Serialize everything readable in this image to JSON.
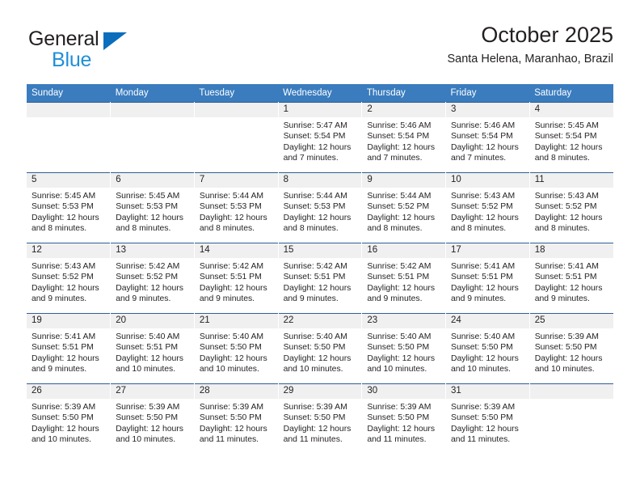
{
  "brand": {
    "name_top": "General",
    "name_bottom": "Blue",
    "triangle_color": "#0a6ebd",
    "blue_text_color": "#1f8fd8",
    "dark_text_color": "#231f20"
  },
  "header": {
    "title": "October 2025",
    "subtitle": "Santa Helena, Maranhao, Brazil"
  },
  "theme": {
    "header_bar_color": "#3a7cbe",
    "row_border_color": "#2f5f94",
    "daynum_bg_color": "#f0f0f0",
    "cell_bg_color": "#ffffff"
  },
  "calendar": {
    "weekday_headers": [
      "Sunday",
      "Monday",
      "Tuesday",
      "Wednesday",
      "Thursday",
      "Friday",
      "Saturday"
    ],
    "weeks": [
      [
        {
          "day": "",
          "sunrise": "",
          "sunset": "",
          "daylight_line1": "",
          "daylight_line2": ""
        },
        {
          "day": "",
          "sunrise": "",
          "sunset": "",
          "daylight_line1": "",
          "daylight_line2": ""
        },
        {
          "day": "",
          "sunrise": "",
          "sunset": "",
          "daylight_line1": "",
          "daylight_line2": ""
        },
        {
          "day": "1",
          "sunrise": "Sunrise: 5:47 AM",
          "sunset": "Sunset: 5:54 PM",
          "daylight_line1": "Daylight: 12 hours",
          "daylight_line2": "and 7 minutes."
        },
        {
          "day": "2",
          "sunrise": "Sunrise: 5:46 AM",
          "sunset": "Sunset: 5:54 PM",
          "daylight_line1": "Daylight: 12 hours",
          "daylight_line2": "and 7 minutes."
        },
        {
          "day": "3",
          "sunrise": "Sunrise: 5:46 AM",
          "sunset": "Sunset: 5:54 PM",
          "daylight_line1": "Daylight: 12 hours",
          "daylight_line2": "and 7 minutes."
        },
        {
          "day": "4",
          "sunrise": "Sunrise: 5:45 AM",
          "sunset": "Sunset: 5:54 PM",
          "daylight_line1": "Daylight: 12 hours",
          "daylight_line2": "and 8 minutes."
        }
      ],
      [
        {
          "day": "5",
          "sunrise": "Sunrise: 5:45 AM",
          "sunset": "Sunset: 5:53 PM",
          "daylight_line1": "Daylight: 12 hours",
          "daylight_line2": "and 8 minutes."
        },
        {
          "day": "6",
          "sunrise": "Sunrise: 5:45 AM",
          "sunset": "Sunset: 5:53 PM",
          "daylight_line1": "Daylight: 12 hours",
          "daylight_line2": "and 8 minutes."
        },
        {
          "day": "7",
          "sunrise": "Sunrise: 5:44 AM",
          "sunset": "Sunset: 5:53 PM",
          "daylight_line1": "Daylight: 12 hours",
          "daylight_line2": "and 8 minutes."
        },
        {
          "day": "8",
          "sunrise": "Sunrise: 5:44 AM",
          "sunset": "Sunset: 5:53 PM",
          "daylight_line1": "Daylight: 12 hours",
          "daylight_line2": "and 8 minutes."
        },
        {
          "day": "9",
          "sunrise": "Sunrise: 5:44 AM",
          "sunset": "Sunset: 5:52 PM",
          "daylight_line1": "Daylight: 12 hours",
          "daylight_line2": "and 8 minutes."
        },
        {
          "day": "10",
          "sunrise": "Sunrise: 5:43 AM",
          "sunset": "Sunset: 5:52 PM",
          "daylight_line1": "Daylight: 12 hours",
          "daylight_line2": "and 8 minutes."
        },
        {
          "day": "11",
          "sunrise": "Sunrise: 5:43 AM",
          "sunset": "Sunset: 5:52 PM",
          "daylight_line1": "Daylight: 12 hours",
          "daylight_line2": "and 8 minutes."
        }
      ],
      [
        {
          "day": "12",
          "sunrise": "Sunrise: 5:43 AM",
          "sunset": "Sunset: 5:52 PM",
          "daylight_line1": "Daylight: 12 hours",
          "daylight_line2": "and 9 minutes."
        },
        {
          "day": "13",
          "sunrise": "Sunrise: 5:42 AM",
          "sunset": "Sunset: 5:52 PM",
          "daylight_line1": "Daylight: 12 hours",
          "daylight_line2": "and 9 minutes."
        },
        {
          "day": "14",
          "sunrise": "Sunrise: 5:42 AM",
          "sunset": "Sunset: 5:51 PM",
          "daylight_line1": "Daylight: 12 hours",
          "daylight_line2": "and 9 minutes."
        },
        {
          "day": "15",
          "sunrise": "Sunrise: 5:42 AM",
          "sunset": "Sunset: 5:51 PM",
          "daylight_line1": "Daylight: 12 hours",
          "daylight_line2": "and 9 minutes."
        },
        {
          "day": "16",
          "sunrise": "Sunrise: 5:42 AM",
          "sunset": "Sunset: 5:51 PM",
          "daylight_line1": "Daylight: 12 hours",
          "daylight_line2": "and 9 minutes."
        },
        {
          "day": "17",
          "sunrise": "Sunrise: 5:41 AM",
          "sunset": "Sunset: 5:51 PM",
          "daylight_line1": "Daylight: 12 hours",
          "daylight_line2": "and 9 minutes."
        },
        {
          "day": "18",
          "sunrise": "Sunrise: 5:41 AM",
          "sunset": "Sunset: 5:51 PM",
          "daylight_line1": "Daylight: 12 hours",
          "daylight_line2": "and 9 minutes."
        }
      ],
      [
        {
          "day": "19",
          "sunrise": "Sunrise: 5:41 AM",
          "sunset": "Sunset: 5:51 PM",
          "daylight_line1": "Daylight: 12 hours",
          "daylight_line2": "and 9 minutes."
        },
        {
          "day": "20",
          "sunrise": "Sunrise: 5:40 AM",
          "sunset": "Sunset: 5:51 PM",
          "daylight_line1": "Daylight: 12 hours",
          "daylight_line2": "and 10 minutes."
        },
        {
          "day": "21",
          "sunrise": "Sunrise: 5:40 AM",
          "sunset": "Sunset: 5:50 PM",
          "daylight_line1": "Daylight: 12 hours",
          "daylight_line2": "and 10 minutes."
        },
        {
          "day": "22",
          "sunrise": "Sunrise: 5:40 AM",
          "sunset": "Sunset: 5:50 PM",
          "daylight_line1": "Daylight: 12 hours",
          "daylight_line2": "and 10 minutes."
        },
        {
          "day": "23",
          "sunrise": "Sunrise: 5:40 AM",
          "sunset": "Sunset: 5:50 PM",
          "daylight_line1": "Daylight: 12 hours",
          "daylight_line2": "and 10 minutes."
        },
        {
          "day": "24",
          "sunrise": "Sunrise: 5:40 AM",
          "sunset": "Sunset: 5:50 PM",
          "daylight_line1": "Daylight: 12 hours",
          "daylight_line2": "and 10 minutes."
        },
        {
          "day": "25",
          "sunrise": "Sunrise: 5:39 AM",
          "sunset": "Sunset: 5:50 PM",
          "daylight_line1": "Daylight: 12 hours",
          "daylight_line2": "and 10 minutes."
        }
      ],
      [
        {
          "day": "26",
          "sunrise": "Sunrise: 5:39 AM",
          "sunset": "Sunset: 5:50 PM",
          "daylight_line1": "Daylight: 12 hours",
          "daylight_line2": "and 10 minutes."
        },
        {
          "day": "27",
          "sunrise": "Sunrise: 5:39 AM",
          "sunset": "Sunset: 5:50 PM",
          "daylight_line1": "Daylight: 12 hours",
          "daylight_line2": "and 10 minutes."
        },
        {
          "day": "28",
          "sunrise": "Sunrise: 5:39 AM",
          "sunset": "Sunset: 5:50 PM",
          "daylight_line1": "Daylight: 12 hours",
          "daylight_line2": "and 11 minutes."
        },
        {
          "day": "29",
          "sunrise": "Sunrise: 5:39 AM",
          "sunset": "Sunset: 5:50 PM",
          "daylight_line1": "Daylight: 12 hours",
          "daylight_line2": "and 11 minutes."
        },
        {
          "day": "30",
          "sunrise": "Sunrise: 5:39 AM",
          "sunset": "Sunset: 5:50 PM",
          "daylight_line1": "Daylight: 12 hours",
          "daylight_line2": "and 11 minutes."
        },
        {
          "day": "31",
          "sunrise": "Sunrise: 5:39 AM",
          "sunset": "Sunset: 5:50 PM",
          "daylight_line1": "Daylight: 12 hours",
          "daylight_line2": "and 11 minutes."
        },
        {
          "day": "",
          "sunrise": "",
          "sunset": "",
          "daylight_line1": "",
          "daylight_line2": ""
        }
      ]
    ]
  }
}
